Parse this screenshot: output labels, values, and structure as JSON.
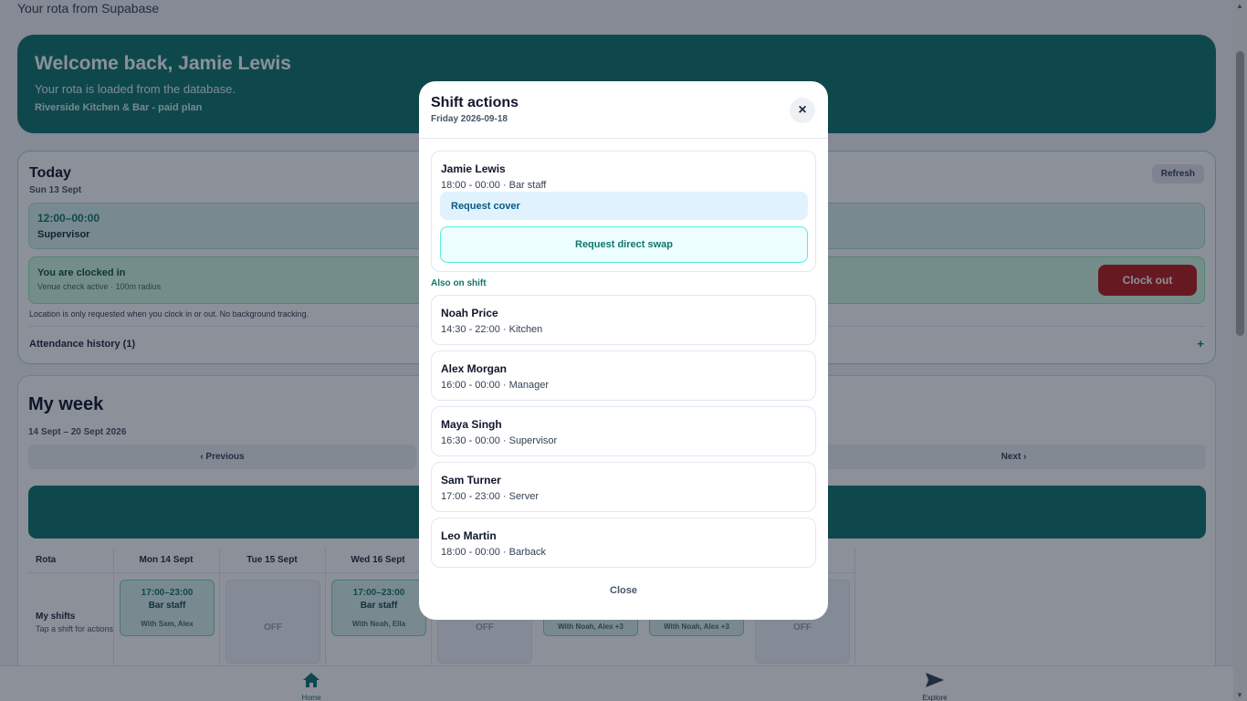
{
  "page": {
    "caption": "Your rota from Supabase",
    "welcome": {
      "title": "Welcome back, Jamie Lewis",
      "subtitle": "Your rota is loaded from the database.",
      "plan": "Riverside Kitchen & Bar - paid plan"
    },
    "today": {
      "title": "Today",
      "date": "Sun 13 Sept",
      "refresh_label": "Refresh",
      "shift_time": "12:00–00:00",
      "shift_role": "Supervisor",
      "clock_status": "You are clocked in",
      "clock_sub": "Venue check active · 100m radius",
      "clockout_label": "Clock out",
      "location_note": "Location is only requested when you clock in or out. No background tracking.",
      "attendance_label": "Attendance history (1)",
      "attendance_toggle": "+"
    },
    "week": {
      "title": "My week",
      "range": "14 Sept – 20 Sept 2026",
      "prev_label": "‹ Previous",
      "next_label": "Next ›",
      "rota_header": "Rota",
      "days": [
        "Mon 14 Sept",
        "Tue 15 Sept",
        "Wed 16 Sept"
      ],
      "row_label": "My shifts",
      "row_sub": "Tap a shift for actions",
      "cells": [
        {
          "time": "17:00–23:00",
          "role": "Bar staff",
          "with": "With Sam, Alex"
        },
        {
          "off": "OFF"
        },
        {
          "time": "17:00–23:00",
          "role": "Bar staff",
          "with": "With Noah, Ella"
        },
        {
          "off": "OFF"
        },
        {
          "with": "With Noah, Alex +3"
        },
        {
          "with": "With Noah, Alex +3"
        },
        {
          "off": "OFF"
        }
      ]
    },
    "nav": {
      "home": "Home",
      "explore": "Explore"
    }
  },
  "modal": {
    "title": "Shift actions",
    "date": "Friday 2026-09-18",
    "close_icon": "×",
    "my_shift": {
      "name": "Jamie Lewis",
      "detail": "18:00 - 00:00 · Bar staff",
      "request_cover": "Request cover",
      "request_swap": "Request direct swap"
    },
    "also_label": "Also on shift",
    "colleagues": [
      {
        "name": "Noah Price",
        "detail": "14:30 - 22:00 · Kitchen"
      },
      {
        "name": "Alex Morgan",
        "detail": "16:00 - 00:00 · Manager"
      },
      {
        "name": "Maya Singh",
        "detail": "16:30 - 00:00 · Supervisor"
      },
      {
        "name": "Sam Turner",
        "detail": "17:00 - 23:00 · Server"
      },
      {
        "name": "Leo Martin",
        "detail": "18:00 - 00:00 · Barback"
      }
    ],
    "close_label": "Close"
  },
  "colors": {
    "teal": "#0f766e",
    "danger": "#b91c1c"
  }
}
